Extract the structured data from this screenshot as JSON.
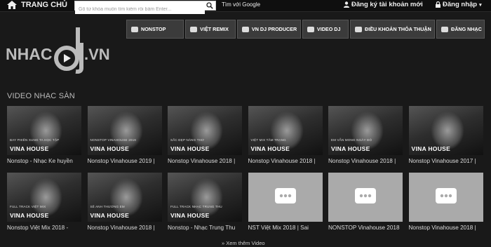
{
  "topbar": {
    "home_label": "TRANG CHỦ",
    "search_placeholder": "Gõ từ khóa muốn tìm kiếm rồi bấm Enter...",
    "google_label": "Tìm với Google",
    "register_label": "Đăng ký tài khoản mới",
    "login_label": "Đăng nhập"
  },
  "nav": {
    "items": [
      {
        "label": "NONSTOP",
        "icon": "disc-icon"
      },
      {
        "label": "VIỆT REMIX",
        "icon": "disc-icon"
      },
      {
        "label": "VN DJ PRODUCER",
        "icon": "user-icon"
      },
      {
        "label": "VIDEO DJ",
        "icon": "video-icon"
      },
      {
        "label": "ĐIỀU KHOẢN THỎA THUẬN",
        "icon": "document-icon"
      },
      {
        "label": "ĐĂNG NHẠC",
        "icon": "upload-icon"
      }
    ]
  },
  "logo": {
    "left": "NHAC",
    "right": ".VN"
  },
  "section": {
    "title": "VIDEO NHẠC SÀN"
  },
  "videos": [
    {
      "title": "Nonstop - Nhạc Ke huyền",
      "overlay_sub": "BAY PHIÊN XUNG TA HỌC TẬP",
      "watermark": "VINA HOUSE",
      "placeholder": false
    },
    {
      "title": "Nonstop Vinahouse 2019 |",
      "overlay_sub": "NONSTOP VINAHOUSE 2019",
      "watermark": "VINA HOUSE",
      "placeholder": false
    },
    {
      "title": "Nonstop Vinahouse 2018 |",
      "overlay_sub": "SẮC ĐẸP NÀNG THƠ",
      "watermark": "VINA HOUSE",
      "placeholder": false
    },
    {
      "title": "Nonstop Vinahouse 2018 |",
      "overlay_sub": "VIỆT MIX TÂM TRẠNG",
      "watermark": "VINA HOUSE",
      "placeholder": false
    },
    {
      "title": "Nonstop Vinahouse 2018 |",
      "overlay_sub": "EM VẪN MONG NGÀY ĐÓ",
      "watermark": "VINA HOUSE",
      "placeholder": false
    },
    {
      "title": "Nonstop Vinahouse 2017 |",
      "overlay_sub": "",
      "watermark": "VINA HOUSE",
      "placeholder": false
    },
    {
      "title": "Nonstop Việt Mix 2018 -",
      "overlay_sub": "FULL TRACK VIỆT MIX",
      "watermark": "VINA HOUSE",
      "placeholder": false
    },
    {
      "title": "Nonstop Vinahouse 2018 |",
      "overlay_sub": "SẼ ANH THƯƠNG EM",
      "watermark": "VINA HOUSE",
      "placeholder": false
    },
    {
      "title": "Nonstop - Nhạc Trung Thu",
      "overlay_sub": "FULL TRACK NHẠC TRUNG THU",
      "watermark": "VINA HOUSE",
      "placeholder": false
    },
    {
      "title": "NST Việt Mix 2018 | Sai",
      "overlay_sub": "",
      "watermark": "",
      "placeholder": true
    },
    {
      "title": "NONSTOP Vinahouse 2018",
      "overlay_sub": "",
      "watermark": "",
      "placeholder": true
    },
    {
      "title": "Nonstop Vinahouse 2018 |",
      "overlay_sub": "",
      "watermark": "",
      "placeholder": true
    }
  ],
  "more_label": "» Xem thêm Video"
}
